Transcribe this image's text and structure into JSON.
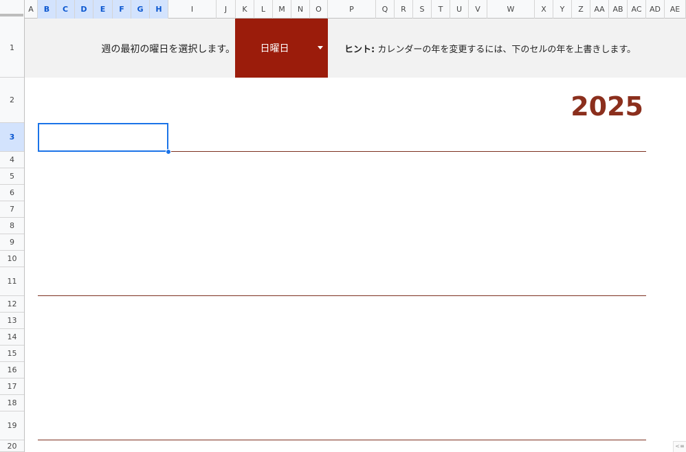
{
  "sheet": {
    "columns": [
      "A",
      "B",
      "C",
      "D",
      "E",
      "F",
      "G",
      "H",
      "I",
      "J",
      "K",
      "L",
      "M",
      "N",
      "O",
      "P",
      "Q",
      "R",
      "S",
      "T",
      "U",
      "V",
      "W",
      "X",
      "Y",
      "Z",
      "AA",
      "AB",
      "AC",
      "AD",
      "AE"
    ],
    "rows": [
      "1",
      "2",
      "3",
      "4",
      "5",
      "6",
      "7",
      "8",
      "9",
      "10",
      "11",
      "12",
      "13",
      "14",
      "15",
      "16",
      "17",
      "18",
      "19",
      "20"
    ],
    "selected_columns": [
      "B",
      "C",
      "D",
      "E",
      "F",
      "G",
      "H"
    ],
    "selected_row": "3"
  },
  "banner": {
    "week_start_label": "週の最初の曜日を選択します。",
    "week_start_value": "日曜日",
    "hint_label": "ヒント:",
    "hint_text": " カレンダーの年を変更するには、下のセルの年を上書きします。"
  },
  "calendar": {
    "year": "2025"
  },
  "colors": {
    "accent": "#9b1c0b",
    "year_text": "#8b2f1d",
    "divider": "#7b2e1d",
    "selection": "#1a73e8",
    "banner_bg": "#f2f2f2"
  },
  "icons": {
    "dropdown": "dropdown-arrow-icon",
    "explore": "explore-icon"
  },
  "explore_tab_glyph": "<≡"
}
